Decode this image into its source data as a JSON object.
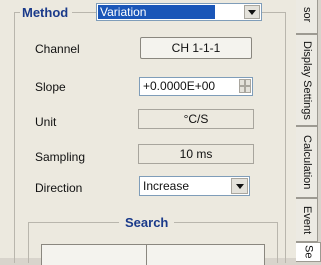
{
  "method": {
    "title": "Method",
    "selected": "Variation"
  },
  "rows": {
    "channel": {
      "label": "Channel",
      "value": "CH 1-1-1"
    },
    "slope": {
      "label": "Slope",
      "value": "+0.0000E+00"
    },
    "unit": {
      "label": "Unit",
      "value": "°C/S"
    },
    "sampling": {
      "label": "Sampling",
      "value": "10 ms"
    },
    "direction": {
      "label": "Direction",
      "value": "Increase"
    }
  },
  "search": {
    "title": "Search"
  },
  "tabs": [
    {
      "label": "sor"
    },
    {
      "label": "Display Settings"
    },
    {
      "label": "Calculation"
    },
    {
      "label": "Event"
    },
    {
      "label": "Se"
    }
  ],
  "colors": {
    "accent": "#1a3a8a",
    "selection": "#1a56b8",
    "panel": "#ece9df"
  }
}
